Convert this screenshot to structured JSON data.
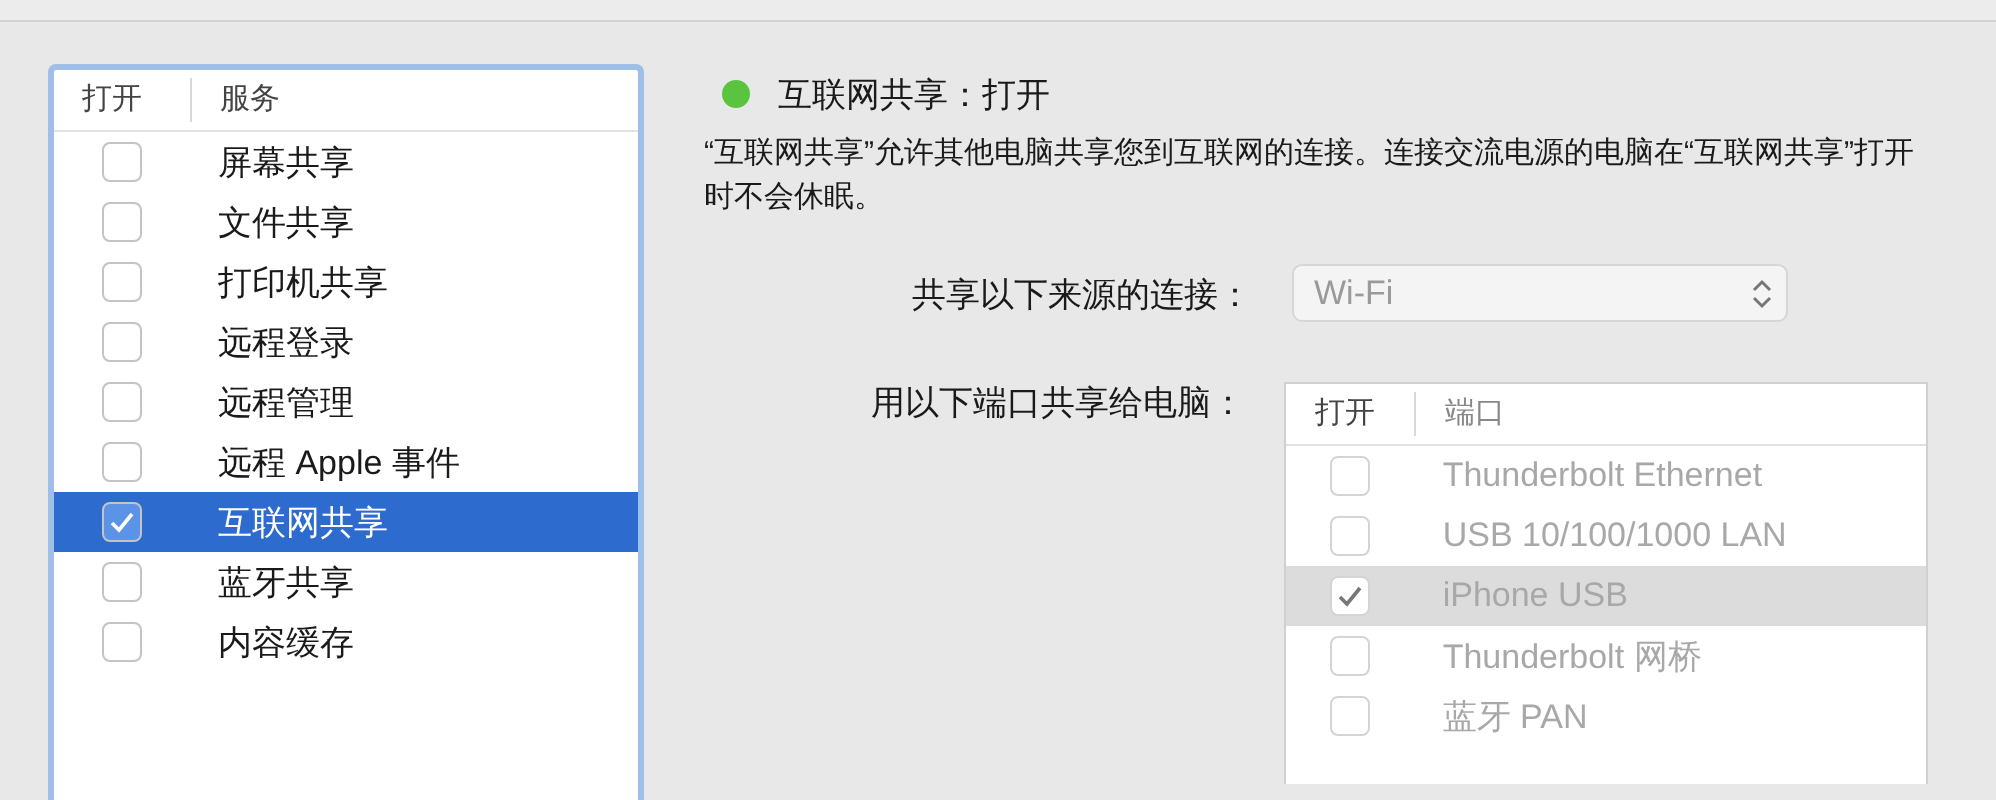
{
  "services": {
    "columns": [
      "打开",
      "服务"
    ],
    "items": [
      {
        "label": "屏幕共享",
        "checked": false,
        "selected": false
      },
      {
        "label": "文件共享",
        "checked": false,
        "selected": false
      },
      {
        "label": "打印机共享",
        "checked": false,
        "selected": false
      },
      {
        "label": "远程登录",
        "checked": false,
        "selected": false
      },
      {
        "label": "远程管理",
        "checked": false,
        "selected": false
      },
      {
        "label": "远程 Apple 事件",
        "checked": false,
        "selected": false
      },
      {
        "label": "互联网共享",
        "checked": true,
        "selected": true
      },
      {
        "label": "蓝牙共享",
        "checked": false,
        "selected": false
      },
      {
        "label": "内容缓存",
        "checked": false,
        "selected": false
      }
    ]
  },
  "detail": {
    "status": {
      "text": "互联网共享：打开",
      "color": "#5ac43f"
    },
    "description": "“互联网共享”允许其他电脑共享您到互联网的连接。连接交流电源的电脑在“互联网共享”打开时不会休眠。",
    "source": {
      "label": "共享以下来源的连接：",
      "value": "Wi-Fi"
    },
    "ports": {
      "label": "用以下端口共享给电脑：",
      "disabled": true,
      "columns": [
        "打开",
        "端口"
      ],
      "items": [
        {
          "label": "Thunderbolt Ethernet",
          "checked": false,
          "selected": false
        },
        {
          "label": "USB 10/100/1000 LAN",
          "checked": false,
          "selected": false
        },
        {
          "label": "iPhone USB",
          "checked": true,
          "selected": true
        },
        {
          "label": "Thunderbolt 网桥",
          "checked": false,
          "selected": false
        },
        {
          "label": "蓝牙 PAN",
          "checked": false,
          "selected": false
        }
      ]
    }
  }
}
